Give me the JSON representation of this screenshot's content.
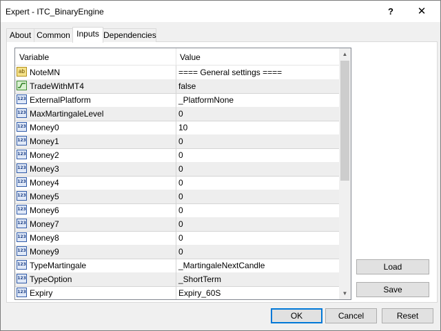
{
  "window": {
    "title": "Expert - ITC_BinaryEngine",
    "help_label": "?",
    "close_label": "✕"
  },
  "tabs": [
    {
      "label": "About"
    },
    {
      "label": "Common"
    },
    {
      "label": "Inputs"
    },
    {
      "label": "Dependencies"
    }
  ],
  "grid": {
    "header": {
      "variable": "Variable",
      "value": "Value"
    },
    "rows": [
      {
        "icon": "text-icon",
        "name": "NoteMN",
        "value": "==== General settings ===="
      },
      {
        "icon": "bool-icon",
        "name": "TradeWithMT4",
        "value": "false"
      },
      {
        "icon": "number-icon",
        "name": "ExternalPlatform",
        "value": "_PlatformNone"
      },
      {
        "icon": "number-icon",
        "name": "MaxMartingaleLevel",
        "value": "0"
      },
      {
        "icon": "number-icon",
        "name": "Money0",
        "value": "10"
      },
      {
        "icon": "number-icon",
        "name": "Money1",
        "value": "0"
      },
      {
        "icon": "number-icon",
        "name": "Money2",
        "value": "0"
      },
      {
        "icon": "number-icon",
        "name": "Money3",
        "value": "0"
      },
      {
        "icon": "number-icon",
        "name": "Money4",
        "value": "0"
      },
      {
        "icon": "number-icon",
        "name": "Money5",
        "value": "0"
      },
      {
        "icon": "number-icon",
        "name": "Money6",
        "value": "0"
      },
      {
        "icon": "number-icon",
        "name": "Money7",
        "value": "0"
      },
      {
        "icon": "number-icon",
        "name": "Money8",
        "value": "0"
      },
      {
        "icon": "number-icon",
        "name": "Money9",
        "value": "0"
      },
      {
        "icon": "number-icon",
        "name": "TypeMartingale",
        "value": "_MartingaleNextCandle"
      },
      {
        "icon": "number-icon",
        "name": "TypeOption",
        "value": "_ShortTerm"
      },
      {
        "icon": "number-icon",
        "name": "Expiry",
        "value": "Expiry_60S"
      }
    ],
    "icon_text": {
      "number": "123",
      "text": "ab"
    }
  },
  "side_buttons": {
    "load": "Load",
    "save": "Save"
  },
  "footer_buttons": {
    "ok": "OK",
    "cancel": "Cancel",
    "reset": "Reset"
  }
}
